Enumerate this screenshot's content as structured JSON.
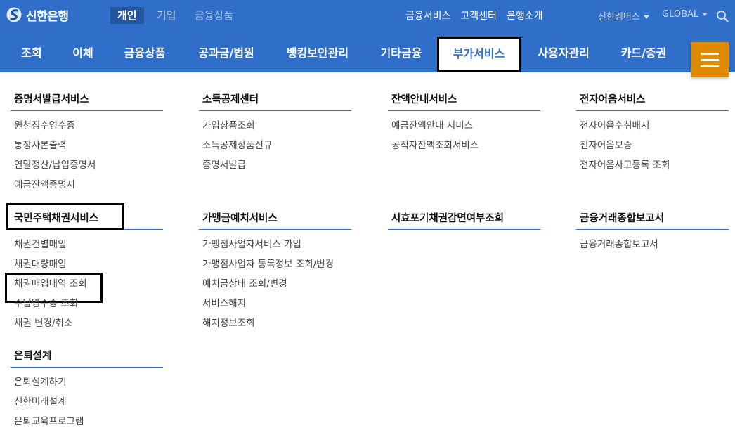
{
  "brand": {
    "name": "신한은행",
    "logo_icon": "shinhan-logo-icon"
  },
  "segments": [
    {
      "label": "개인",
      "active": true
    },
    {
      "label": "기업",
      "active": false
    },
    {
      "label": "금융상품",
      "active": false
    }
  ],
  "top_links": [
    "금융서비스",
    "고객센터",
    "은행소개"
  ],
  "utility": {
    "membership": "신한멤버스",
    "global": "GLOBAL"
  },
  "colors": {
    "primary": "#2f6ec9",
    "accent": "#e08a00",
    "highlight_box": "#000000"
  },
  "gnb": [
    {
      "label": "조회"
    },
    {
      "label": "이체"
    },
    {
      "label": "금융상품"
    },
    {
      "label": "공과금/법원"
    },
    {
      "label": "뱅킹보안관리"
    },
    {
      "label": "기타금융"
    },
    {
      "label": "부가서비스",
      "active": true
    },
    {
      "label": "사용자관리"
    },
    {
      "label": "카드/증권"
    }
  ],
  "menu": [
    {
      "title": "증명서발급서비스",
      "items": [
        "원천징수영수증",
        "통장사본출력",
        "연말정산/납입증명서",
        "예금잔액증명서"
      ]
    },
    {
      "title": "소득공제센터",
      "items": [
        "가입상품조회",
        "소득공제상품신규",
        "증명서발급"
      ]
    },
    {
      "title": "잔액안내서비스",
      "items": [
        "예금잔액안내 서비스",
        "공직자잔액조회서비스"
      ]
    },
    {
      "title": "전자어음서비스",
      "items": [
        "전자어음수취배서",
        "전자어음보증",
        "전자어음사고등록 조회"
      ]
    },
    {
      "title": "국민주택채권서비스",
      "items": [
        "채권건별매입",
        "채권대량매입",
        "채권매입내역 조회",
        "수납영수증 조회",
        "채권 변경/취소"
      ]
    },
    {
      "title": "가맹금예치서비스",
      "items": [
        "가맹점사업자서비스 가입",
        "가맹점사업자 등록정보 조회/변경",
        "예치금상태 조회/변경",
        "서비스해지",
        "해지정보조회"
      ]
    },
    {
      "title": "시효포기채권감면여부조회",
      "items": []
    },
    {
      "title": "금융거래종합보고서",
      "items": [
        "금융거래종합보고서"
      ]
    },
    {
      "title": "은퇴설계",
      "items": [
        "은퇴설계하기",
        "신한미래설계",
        "은퇴교육프로그램"
      ]
    }
  ]
}
